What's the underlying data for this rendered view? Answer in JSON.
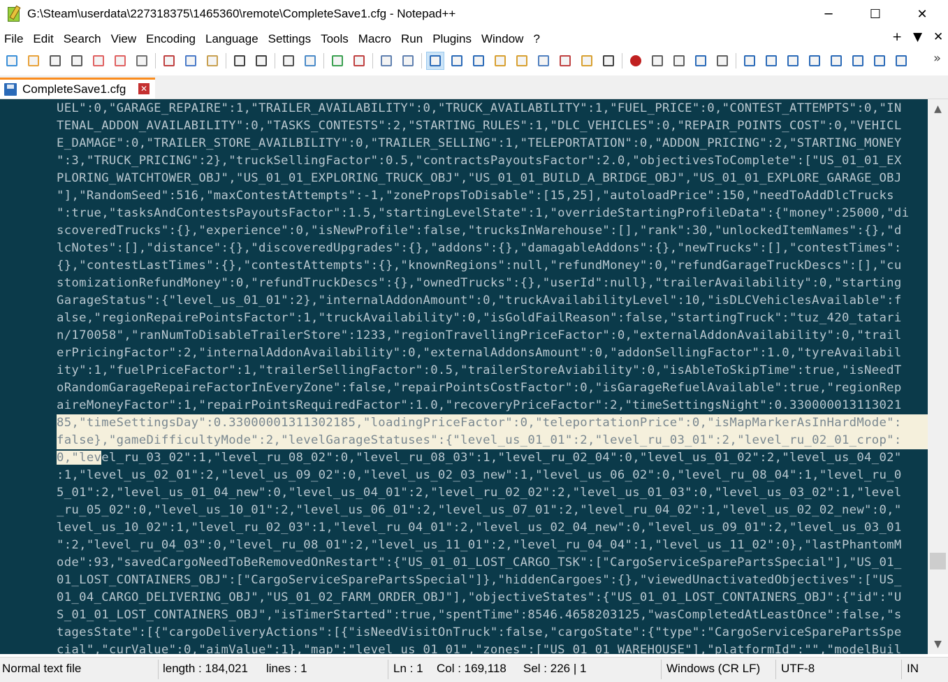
{
  "window": {
    "title": "G:\\Steam\\userdata\\227318375\\1465360\\remote\\CompleteSave1.cfg - Notepad++",
    "minimize": "─",
    "maximize": "☐",
    "close": "✕"
  },
  "menu": {
    "items": [
      "File",
      "Edit",
      "Search",
      "View",
      "Encoding",
      "Language",
      "Settings",
      "Tools",
      "Macro",
      "Run",
      "Plugins",
      "Window",
      "?"
    ],
    "right": [
      "+",
      "▼",
      "✕"
    ]
  },
  "toolbar": {
    "icons": [
      "new-file-icon",
      "open-file-icon",
      "save-icon",
      "save-all-icon",
      "close-icon",
      "close-all-icon",
      "print-icon",
      "cut-icon",
      "copy-icon",
      "paste-icon",
      "undo-icon",
      "redo-icon",
      "find-icon",
      "replace-icon",
      "zoom-in-icon",
      "zoom-out-icon",
      "sync-vertical-icon",
      "sync-horizontal-icon",
      "word-wrap-icon",
      "show-all-characters-icon",
      "indent-guide-icon",
      "user-defined-language-icon",
      "document-map-icon",
      "document-list-icon",
      "function-list-icon",
      "folder-as-workspace-icon",
      "monitoring-icon",
      "record-macro-icon",
      "stop-record-icon",
      "play-macro-icon",
      "run-macro-multiple-icon",
      "save-macro-icon",
      "plugin-1-icon",
      "plugin-2-icon",
      "plugin-3-icon",
      "plugin-4-icon",
      "plugin-5-icon",
      "plugin-6-icon",
      "plugin-7-icon",
      "plugin-8-icon"
    ],
    "overflow": "»"
  },
  "tab": {
    "label": "CompleteSave1.cfg",
    "close": "✕"
  },
  "editor": {
    "lines": [
      "UEL\":0,\"GARAGE_REPAIRE\":1,\"TRAILER_AVAILABILITY\":0,\"TRUCK_AVAILABILITY\":1,\"FUEL_PRICE\":0,\"CONTEST_ATTEMPTS\":0,\"IN",
      "TENAL_ADDON_AVAILABILITY\":0,\"TASKS_CONTESTS\":2,\"STARTING_RULES\":1,\"DLC_VEHICLES\":0,\"REPAIR_POINTS_COST\":0,\"VEHICL",
      "E_DAMAGE\":0,\"TRAILER_STORE_AVAILBILITY\":0,\"TRAILER_SELLING\":1,\"TELEPORTATION\":0,\"ADDON_PRICING\":2,\"STARTING_MONEY",
      "\":3,\"TRUCK_PRICING\":2},\"truckSellingFactor\":0.5,\"contractsPayoutsFactor\":2.0,\"objectivesToComplete\":[\"US_01_01_EX",
      "PLORING_WATCHTOWER_OBJ\",\"US_01_01_EXPLORING_TRUCK_OBJ\",\"US_01_01_BUILD_A_BRIDGE_OBJ\",\"US_01_01_EXPLORE_GARAGE_OBJ",
      "\"],\"RandomSeed\":516,\"maxContestAttempts\":-1,\"zonePropsToDisable\":[15,25],\"autoloadPrice\":150,\"needToAddDlcTrucks",
      "\":true,\"tasksAndContestsPayoutsFactor\":1.5,\"startingLevelState\":1,\"overrideStartingProfileData\":{\"money\":25000,\"di",
      "scoveredTrucks\":{},\"experience\":0,\"isNewProfile\":false,\"trucksInWarehouse\":[],\"rank\":30,\"unlockedItemNames\":{},\"d",
      "lcNotes\":[],\"distance\":{},\"discoveredUpgrades\":{},\"addons\":{},\"damagableAddons\":{},\"newTrucks\":[],\"contestTimes\":",
      "{},\"contestLastTimes\":{},\"contestAttempts\":{},\"knownRegions\":null,\"refundMoney\":0,\"refundGarageTruckDescs\":[],\"cu",
      "stomizationRefundMoney\":0,\"refundTruckDescs\":{},\"ownedTrucks\":{},\"userId\":null},\"trailerAvailability\":0,\"starting",
      "GarageStatus\":{\"level_us_01_01\":2},\"internalAddonAmount\":0,\"truckAvailabilityLevel\":10,\"isDLCVehiclesAvailable\":f",
      "alse,\"regionRepairePointsFactor\":1,\"truckAvailability\":0,\"isGoldFailReason\":false,\"startingTruck\":\"tuz_420_tatari",
      "n/170058\",\"ranNumToDisableTrailerStore\":1233,\"regionTravellingPriceFactor\":0,\"externalAddonAvailability\":0,\"trail",
      "erPricingFactor\":2,\"internalAddonAvailability\":0,\"externalAddonsAmount\":0,\"addonSellingFactor\":1.0,\"tyreAvailabil",
      "ity\":1,\"fuelPriceFactor\":1,\"trailerSellingFactor\":0.5,\"trailerStoreAviability\":0,\"isAbleToSkipTime\":true,\"isNeedT",
      "oRandomGarageRepaireFactorInEveryZone\":false,\"repairPointsCostFactor\":0,\"isGarageRefuelAvailable\":true,\"regionRep",
      "aireMoneyFactor\":1,\"repairPointsRequiredFactor\":1.0,\"recoveryPriceFactor\":2,\"timeSettingsNight\":0.330000013113021",
      "85,\"timeSettingsDay\":0.33000001311302185,\"loadingPriceFactor\":0,\"teleportationPrice\":0,\"isMapMarkerAsInHardMode\":",
      "false},\"gameDifficultyMode\":2,\"levelGarageStatuses\":{\"level_us_01_01\":2,\"level_ru_03_01\":2,\"level_ru_02_01_crop\":",
      "0,\"level_ru_03_02\":1,\"level_ru_08_02\":0,\"level_ru_08_03\":1,\"level_ru_02_04\":0,\"level_us_01_02\":2,\"level_us_04_02\"",
      ":1,\"level_us_02_01\":2,\"level_us_09_02\":0,\"level_us_02_03_new\":1,\"level_us_06_02\":0,\"level_ru_08_04\":1,\"level_ru_0",
      "5_01\":2,\"level_us_01_04_new\":0,\"level_us_04_01\":2,\"level_ru_02_02\":2,\"level_us_01_03\":0,\"level_us_03_02\":1,\"level",
      "_ru_05_02\":0,\"level_us_10_01\":2,\"level_us_06_01\":2,\"level_us_07_01\":2,\"level_ru_04_02\":1,\"level_us_02_02_new\":0,\"",
      "level_us_10_02\":1,\"level_ru_02_03\":1,\"level_ru_04_01\":2,\"level_us_02_04_new\":0,\"level_us_09_01\":2,\"level_us_03_01",
      "\":2,\"level_ru_04_03\":0,\"level_ru_08_01\":2,\"level_us_11_01\":2,\"level_ru_04_04\":1,\"level_us_11_02\":0},\"lastPhantomM",
      "ode\":93,\"savedCargoNeedToBeRemovedOnRestart\":{\"US_01_01_LOST_CARGO_TSK\":[\"CargoServiceSparePartsSpecial\"],\"US_01_",
      "01_LOST_CONTAINERS_OBJ\":[\"CargoServiceSparePartsSpecial\"]},\"hiddenCargoes\":{},\"viewedUnactivatedObjectives\":[\"US_",
      "01_04_CARGO_DELIVERING_OBJ\",\"US_01_02_FARM_ORDER_OBJ\"],\"objectiveStates\":{\"US_01_01_LOST_CONTAINERS_OBJ\":{\"id\":\"U",
      "S_01_01_LOST_CONTAINERS_OBJ\",\"isTimerStarted\":true,\"spentTime\":8546.4658203125,\"wasCompletedAtLeastOnce\":false,\"s",
      "tagesState\":[{\"cargoDeliveryActions\":[{\"isNeedVisitOnTruck\":false,\"cargoState\":{\"type\":\"CargoServiceSparePartsSpe",
      "cial\",\"curValue\":0,\"aimValue\":1},\"map\":\"level_us_01_01\",\"zones\":[\"US_01_01_WAREHOUSE\"],\"platformId\":\"\",\"modelBuil"
    ],
    "highlight_start_line": 17,
    "highlight_end_line": 19,
    "highlight_line_17_prefix": "oRandomGarageRepaireFactorInEveryZone\":false,\"repairPointsCostFactor\":0,\"isGarageRefuelAvailable\":true,\"regionRep",
    "scroll_up": "▲",
    "scroll_down": "▼",
    "scroll_position": 0.87
  },
  "status": {
    "file_type": "Normal text file",
    "length": "length : 184,021",
    "lines": "lines : 1",
    "ln": "Ln : 1",
    "col": "Col : 169,118",
    "sel": "Sel : 226 | 1",
    "eol": "Windows (CR LF)",
    "encoding": "UTF-8",
    "mode": "IN"
  },
  "colors": {
    "editor_bg": "#0b3a4a",
    "editor_text": "#b8c7cf",
    "selection_bg": "#f5f0dc",
    "tab_accent": "#fa8c1e"
  }
}
